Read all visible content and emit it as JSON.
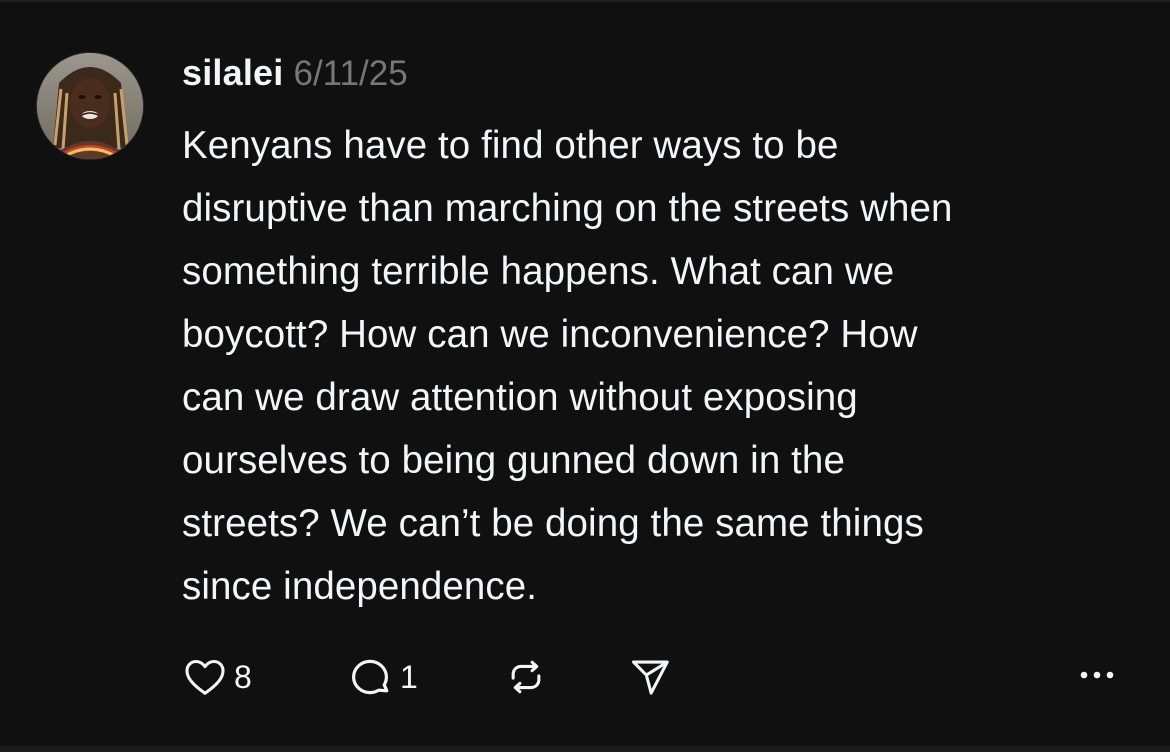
{
  "post": {
    "username": "silalei",
    "timestamp": "6/11/25",
    "text": "Kenyans have to find other ways to be\ndisruptive than marching on the streets when\nsomething terrible happens. What can we\nboycott? How can we inconvenience? How\ncan we draw attention without exposing\nourselves to being gunned down in the\nstreets? We can’t be doing the same things\nsince independence."
  },
  "actions": {
    "like_icon": "heart-icon",
    "like_count": "8",
    "reply_icon": "comment-icon",
    "reply_count": "1",
    "repost_icon": "repost-icon",
    "share_icon": "send-icon",
    "more_icon": "more-icon"
  },
  "theme": {
    "background": "#101010",
    "text": "#f3f5f7",
    "muted": "#777777"
  }
}
